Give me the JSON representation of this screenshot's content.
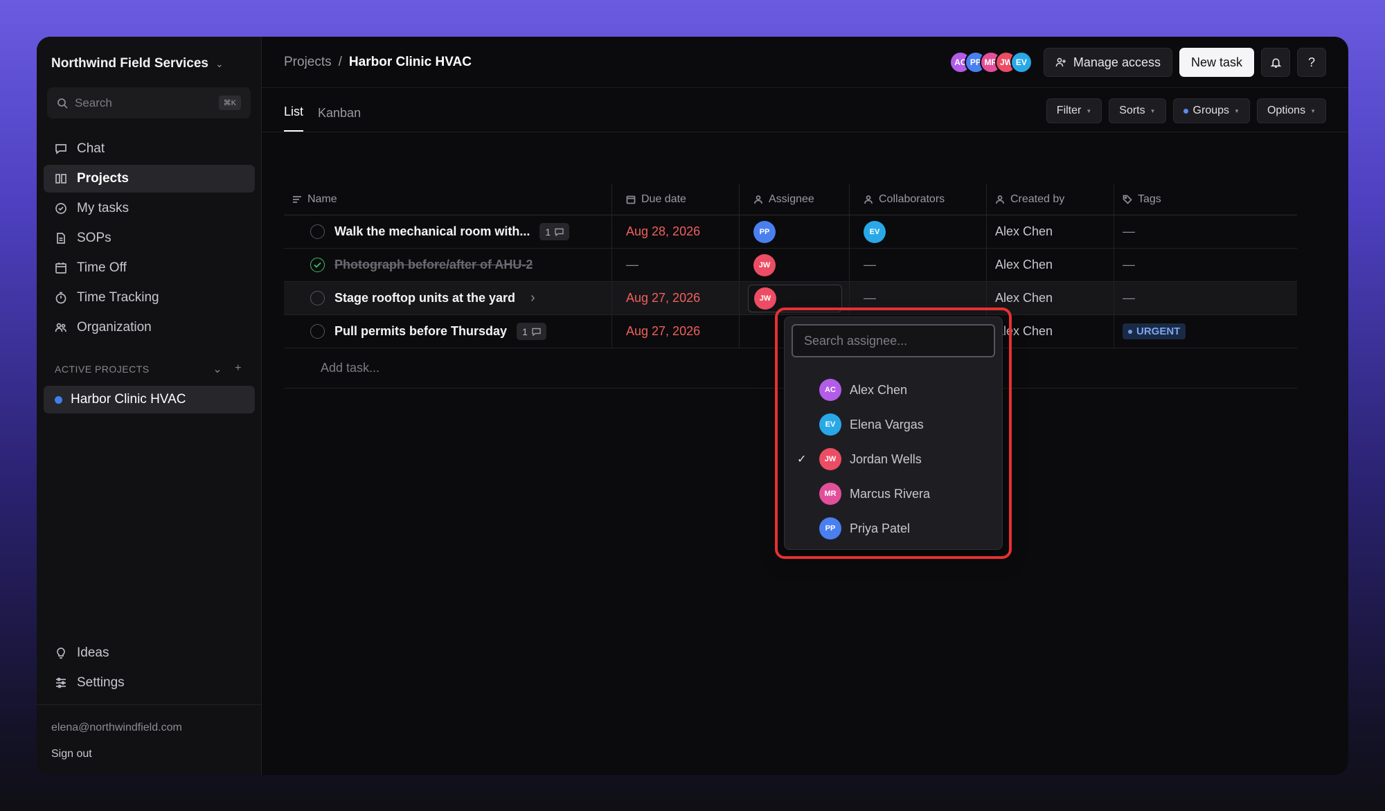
{
  "sidebar": {
    "workspace": "Northwind Field Services",
    "search_placeholder": "Search",
    "search_shortcut": "⌘K",
    "nav": [
      {
        "label": "Chat",
        "icon": "chat-icon"
      },
      {
        "label": "Projects",
        "icon": "projects-icon",
        "active": true
      },
      {
        "label": "My tasks",
        "icon": "check-circle-icon"
      },
      {
        "label": "SOPs",
        "icon": "document-icon"
      },
      {
        "label": "Time Off",
        "icon": "calendar-icon"
      },
      {
        "label": "Time Tracking",
        "icon": "stopwatch-icon"
      },
      {
        "label": "Organization",
        "icon": "people-icon"
      }
    ],
    "section_title": "ACTIVE PROJECTS",
    "active_project": "Harbor Clinic HVAC",
    "bottom_nav": [
      {
        "label": "Ideas",
        "icon": "lightbulb-icon"
      },
      {
        "label": "Settings",
        "icon": "sliders-icon"
      }
    ],
    "email": "elena@northwindfield.com",
    "signout": "Sign out"
  },
  "header": {
    "breadcrumb_root": "Projects",
    "breadcrumb_sep": "/",
    "breadcrumb_current": "Harbor Clinic HVAC",
    "avatars": [
      {
        "initials": "AC",
        "color": "#b25ce8"
      },
      {
        "initials": "PP",
        "color": "#4a7ff0"
      },
      {
        "initials": "MR",
        "color": "#e24f9a"
      },
      {
        "initials": "JW",
        "color": "#ec4d64"
      },
      {
        "initials": "EV",
        "color": "#29a8e8"
      }
    ],
    "manage_access": "Manage access",
    "new_task": "New task",
    "help": "?"
  },
  "views": {
    "tabs": [
      "List",
      "Kanban"
    ],
    "active_tab": "List",
    "filter": "Filter",
    "sorts": "Sorts",
    "groups": "Groups",
    "options": "Options"
  },
  "table": {
    "columns": [
      "Name",
      "Due date",
      "Assignee",
      "Collaborators",
      "Created by",
      "Tags"
    ],
    "rows": [
      {
        "name": "Walk the mechanical room with...",
        "comments": "1",
        "due": "Aug 28, 2026",
        "assignee": "PP",
        "collaborator": "EV",
        "created_by": "Alex Chen",
        "tag": "—"
      },
      {
        "name": "Photograph before/after of AHU-2",
        "due": "—",
        "assignee": "JW",
        "collaborator": "—",
        "created_by": "Alex Chen",
        "tag": "—",
        "done": true
      },
      {
        "name": "Stage rooftop units at the yard",
        "due": "Aug 27, 2026",
        "assignee": "JW",
        "collaborator": "—",
        "created_by": "Alex Chen",
        "tag": "—"
      },
      {
        "name": "Pull permits before Thursday",
        "comments": "1",
        "due": "Aug 27, 2026",
        "assignee": "",
        "collaborator": "",
        "created_by": "Alex Chen",
        "tag": "URGENT"
      }
    ],
    "add_task": "Add task..."
  },
  "assignee_dropdown": {
    "placeholder": "Search assignee...",
    "options": [
      {
        "initials": "AC",
        "name": "Alex Chen",
        "color": "#b25ce8",
        "selected": false
      },
      {
        "initials": "EV",
        "name": "Elena Vargas",
        "color": "#29a8e8",
        "selected": false
      },
      {
        "initials": "JW",
        "name": "Jordan Wells",
        "color": "#ec4d64",
        "selected": true
      },
      {
        "initials": "MR",
        "name": "Marcus Rivera",
        "color": "#e24f9a",
        "selected": false
      },
      {
        "initials": "PP",
        "name": "Priya Patel",
        "color": "#4a7ff0",
        "selected": false
      }
    ],
    "check_mark": "✓"
  },
  "colors": {
    "accent_blue": "#3f7fe8",
    "due_red": "#f0605c",
    "done_green": "#3fbf6b",
    "highlight_red": "#e53131"
  }
}
